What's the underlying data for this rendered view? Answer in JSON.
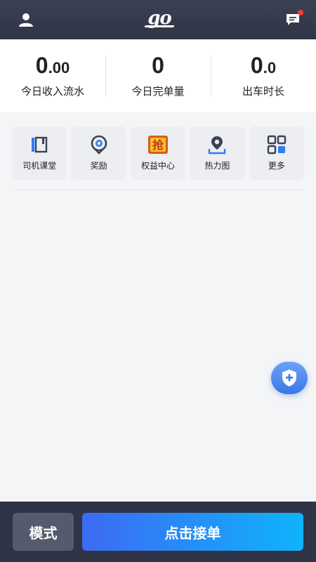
{
  "header": {
    "logo_text": "go",
    "profile_icon": "user-icon",
    "message_icon": "chat-icon",
    "message_badge_color": "#ff3b30"
  },
  "stats": [
    {
      "value_int": "0",
      "value_dec": ".00",
      "label": "今日收入流水"
    },
    {
      "value_int": "0",
      "value_dec": "",
      "label": "今日完单量"
    },
    {
      "value_int": "0",
      "value_dec": ".0",
      "label": "出车时长"
    }
  ],
  "tiles": [
    {
      "label": "司机课堂",
      "icon": "book-icon"
    },
    {
      "label": "奖励",
      "icon": "reward-icon"
    },
    {
      "label": "权益中心",
      "icon": "grab-icon",
      "icon_text": "抢"
    },
    {
      "label": "热力图",
      "icon": "map-pin-icon"
    },
    {
      "label": "更多",
      "icon": "grid-icon"
    }
  ],
  "fab": {
    "icon": "shield-plus-icon"
  },
  "bottom": {
    "mode_label": "模式",
    "accept_label": "点击接单"
  },
  "colors": {
    "topbar": "#2f3446",
    "accent_start": "#3d6af4",
    "accent_end": "#0fb3fb"
  }
}
